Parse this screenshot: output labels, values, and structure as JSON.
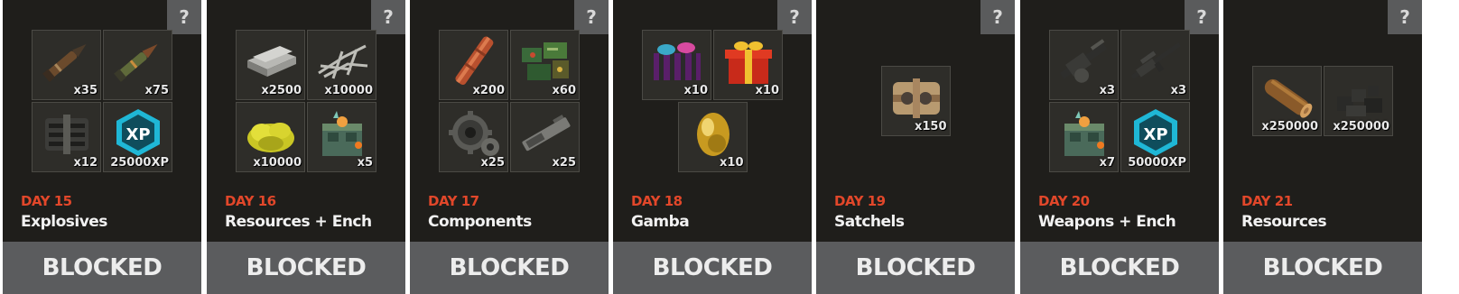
{
  "help_label": "?",
  "cards": [
    {
      "day": "DAY 15",
      "title": "Explosives",
      "status": "BLOCKED",
      "items": [
        {
          "icon": "rocket-icon",
          "qty": "x35"
        },
        {
          "icon": "hv-rocket-icon",
          "qty": "x75"
        },
        {
          "icon": "c4-icon",
          "qty": "x12"
        },
        {
          "icon": "xp-badge-icon",
          "qty": "25000XP"
        }
      ]
    },
    {
      "day": "DAY 16",
      "title": "Resources + Ench",
      "status": "BLOCKED",
      "items": [
        {
          "icon": "metal-ingot-icon",
          "qty": "x2500"
        },
        {
          "icon": "metal-fragments-icon",
          "qty": "x10000"
        },
        {
          "icon": "sulfur-icon",
          "qty": "x10000"
        },
        {
          "icon": "enchant-box-icon",
          "qty": "x5"
        }
      ]
    },
    {
      "day": "DAY 17",
      "title": "Components",
      "status": "BLOCKED",
      "items": [
        {
          "icon": "metal-pipe-icon",
          "qty": "x200"
        },
        {
          "icon": "tech-trash-icon",
          "qty": "x60"
        },
        {
          "icon": "gears-icon",
          "qty": "x25"
        },
        {
          "icon": "rifle-body-icon",
          "qty": "x25"
        }
      ]
    },
    {
      "day": "DAY 18",
      "title": "Gamba",
      "status": "BLOCKED",
      "items": [
        {
          "icon": "purple-gift-icon",
          "qty": "x10"
        },
        {
          "icon": "red-gift-icon",
          "qty": "x10"
        },
        {
          "icon": "golden-egg-icon",
          "qty": "x10"
        }
      ]
    },
    {
      "day": "DAY 19",
      "title": "Satchels",
      "status": "BLOCKED",
      "items": [
        {
          "icon": "satchel-charge-icon",
          "qty": "x150"
        }
      ]
    },
    {
      "day": "DAY 20",
      "title": "Weapons + Ench",
      "status": "BLOCKED",
      "items": [
        {
          "icon": "m249-icon",
          "qty": "x3"
        },
        {
          "icon": "l96-rifle-icon",
          "qty": "x3"
        },
        {
          "icon": "enchant-box-icon",
          "qty": "x7"
        },
        {
          "icon": "xp-badge-icon",
          "qty": "50000XP"
        }
      ]
    },
    {
      "day": "DAY 21",
      "title": "Resources",
      "status": "BLOCKED",
      "items": [
        {
          "icon": "wood-log-icon",
          "qty": "x250000"
        },
        {
          "icon": "charcoal-icon",
          "qty": "x250000"
        }
      ]
    }
  ]
}
